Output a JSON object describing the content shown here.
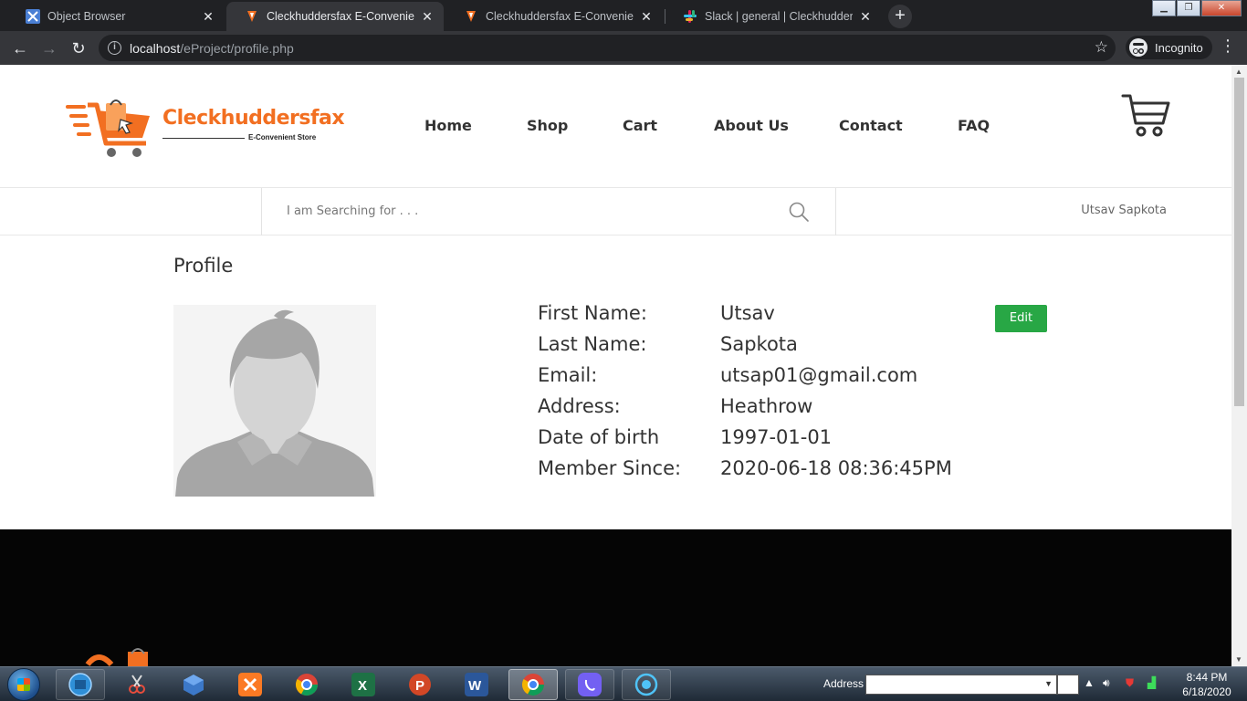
{
  "browser": {
    "tabs": [
      {
        "title": "Object Browser",
        "active": false
      },
      {
        "title": "Cleckhuddersfax E-Convenient St",
        "active": true
      },
      {
        "title": "Cleckhuddersfax E-Convenient St",
        "active": false
      },
      {
        "title": "Slack | general | Cleckhuddersfax",
        "active": false
      }
    ],
    "url_host": "localhost",
    "url_path": "/eProject/profile.php",
    "incognito_label": "Incognito"
  },
  "site": {
    "logo_name": "Cleckhuddersfax",
    "logo_tagline": "E-Convenient Store",
    "nav": [
      "Home",
      "Shop",
      "Cart",
      "About Us",
      "Contact",
      "FAQ"
    ],
    "search_placeholder": "I am Searching for . . .",
    "user_name": "Utsav Sapkota"
  },
  "profile": {
    "title": "Profile",
    "edit_label": "Edit",
    "fields": [
      {
        "label": "First Name:",
        "value": "Utsav"
      },
      {
        "label": "Last Name:",
        "value": "Sapkota"
      },
      {
        "label": "Email:",
        "value": "utsap01@gmail.com"
      },
      {
        "label": "Address:",
        "value": "Heathrow"
      },
      {
        "label": "Date of birth",
        "value": "1997-01-01"
      },
      {
        "label": "Member Since:",
        "value": "2020-06-18 08:36:45PM"
      }
    ]
  },
  "taskbar": {
    "address_label": "Address",
    "time": "8:44 PM",
    "date": "6/18/2020"
  },
  "colors": {
    "brand_orange": "#f26f21",
    "edit_green": "#28a745",
    "footer_bg": "#050505"
  }
}
